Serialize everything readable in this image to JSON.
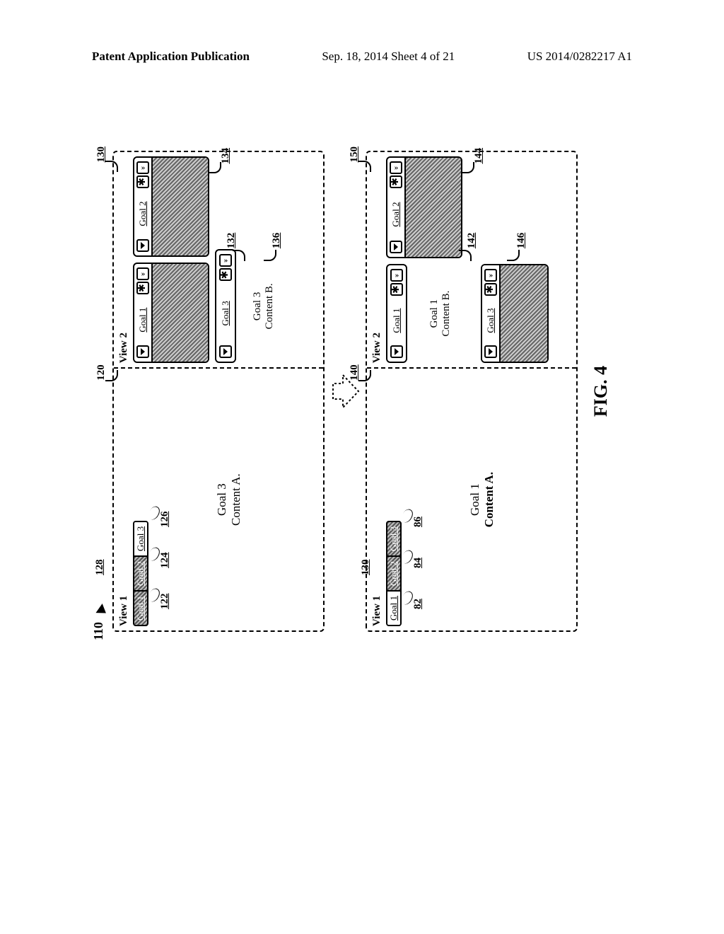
{
  "header": {
    "left": "Patent Application Publication",
    "center": "Sep. 18, 2014  Sheet 4 of 21",
    "right": "US 2014/0282217 A1"
  },
  "figure": {
    "label": "FIG. 4",
    "callout_110": "110",
    "state1": {
      "ref_state": "128",
      "view1": {
        "title": "View 1",
        "ref_panel": "120",
        "tabs": [
          {
            "label": "Goal 1",
            "ref": "122",
            "active": false
          },
          {
            "label": "Goal 2",
            "ref": "124",
            "active": false
          },
          {
            "label": "Goal 3",
            "ref": "126",
            "active": true
          }
        ],
        "content_line1": "Goal 3",
        "content_line2": "Content A."
      },
      "view2": {
        "title": "View 2",
        "ref_panel": "130",
        "row": [
          {
            "title": "Goal 1",
            "shaded": true
          },
          {
            "title": "Goal 2",
            "shaded": true,
            "ref": "134"
          }
        ],
        "bottom": {
          "title": "Goal 3",
          "ref_header": "132",
          "content_line1": "Goal 3",
          "content_line2": "Content B.",
          "ref_body": "136"
        }
      }
    },
    "state2": {
      "ref_state": "130",
      "view1": {
        "title": "View 1",
        "ref_panel": "140",
        "tabs": [
          {
            "label": "Goal 1",
            "ref": "82",
            "active": true
          },
          {
            "label": "Goal 2",
            "ref": "84",
            "active": false
          },
          {
            "label": "Goal 3",
            "ref": "86",
            "active": false
          }
        ],
        "content_line1": "Goal 1",
        "content_line2": "Content A."
      },
      "view2": {
        "title": "View 2",
        "ref_panel": "150",
        "row": [
          {
            "title": "Goal 2",
            "shaded": true,
            "ref": "144"
          }
        ],
        "top": {
          "title": "Goal 1",
          "ref_header": "142",
          "content_line1": "Goal 1",
          "content_line2": "Content B."
        },
        "bottom_collapsed": {
          "title": "Goal 3",
          "ref": "146"
        }
      }
    }
  }
}
